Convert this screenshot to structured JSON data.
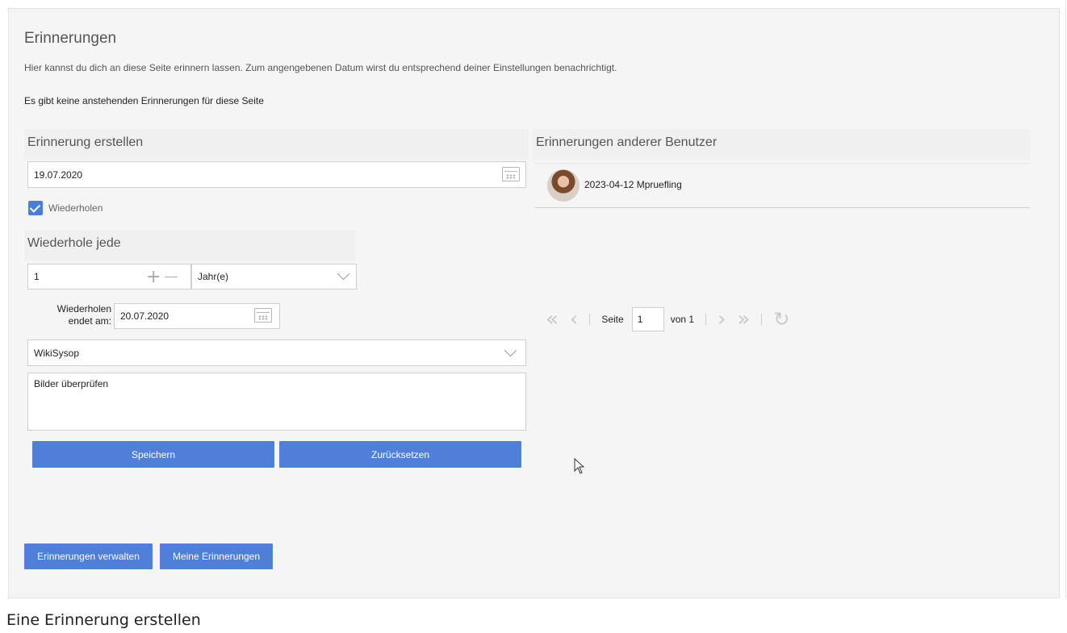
{
  "title": "Erinnerungen",
  "description": "Hier kannst du dich an diese Seite erinnern lassen. Zum angengebenen Datum wirst du entsprechend deiner Einstellungen benachrichtigt.",
  "no_pending": "Es gibt keine anstehenden Erinnerungen für diese Seite",
  "create": {
    "heading": "Erinnerung erstellen",
    "date_value": "19.07.2020",
    "repeat_label": "Wiederholen",
    "repeat_checked": true,
    "repeat_heading": "Wiederhole jede",
    "interval_value": "1",
    "unit_value": "Jahr(e)",
    "ends_label_line1": "Wiederholen",
    "ends_label_line2": "endet am:",
    "ends_value": "20.07.2020",
    "user_value": "WikiSysop",
    "comment_value": "Bilder überprüfen",
    "save_label": "Speichern",
    "reset_label": "Zurücksetzen"
  },
  "others": {
    "heading": "Erinnerungen anderer Benutzer",
    "items": [
      {
        "text": "2023-04-12 Mpruefling"
      }
    ]
  },
  "pager": {
    "page_label": "Seite",
    "page_value": "1",
    "of_label": "von 1"
  },
  "footer_buttons": {
    "manage_label": "Erinnerungen verwalten",
    "mine_label": "Meine Erinnerungen"
  },
  "caption": "Eine Erinnerung erstellen",
  "colors": {
    "accent": "#4e80d9",
    "panel": "#f5f5f5"
  }
}
